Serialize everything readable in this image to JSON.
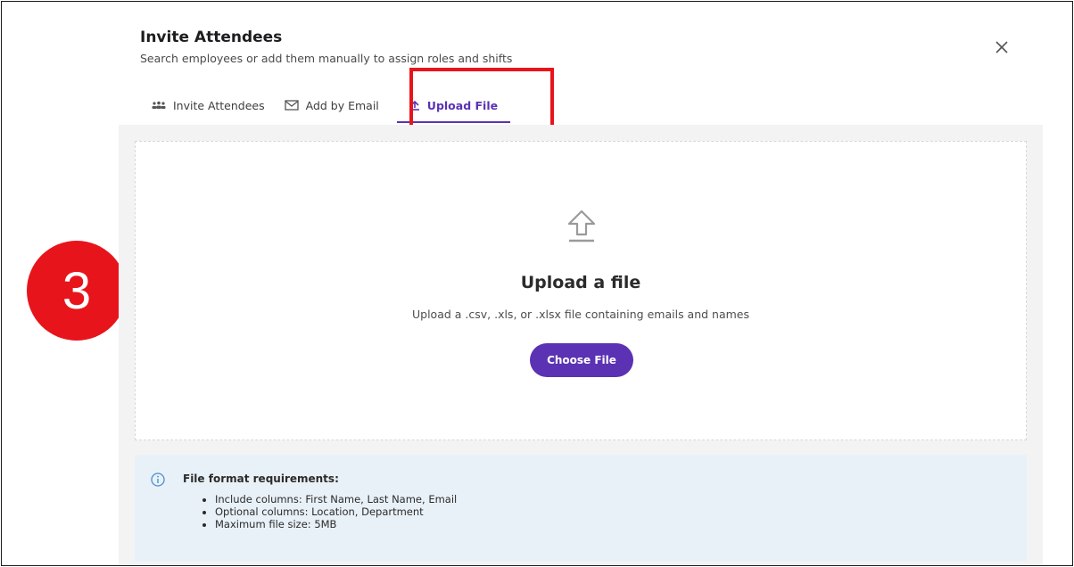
{
  "step_badge": "3",
  "modal": {
    "title": "Invite Attendees",
    "subtitle": "Search employees or add them manually to assign roles and shifts"
  },
  "tabs": [
    {
      "label": "Invite Attendees",
      "icon": "people-icon",
      "active": false
    },
    {
      "label": "Add by Email",
      "icon": "envelope-icon",
      "active": false
    },
    {
      "label": "Upload File",
      "icon": "upload-icon",
      "active": true
    }
  ],
  "upload": {
    "title": "Upload a file",
    "description": "Upload a .csv, .xls, or .xlsx file containing emails and names",
    "button_label": "Choose File"
  },
  "requirements": {
    "heading": "File format requirements:",
    "items": [
      "Include columns: First Name, Last Name, Email",
      "Optional columns: Location, Department",
      "Maximum file size: 5MB"
    ]
  },
  "colors": {
    "accent": "#5b32b3",
    "highlight": "#e8141b",
    "info_background": "#e9f1f8"
  }
}
